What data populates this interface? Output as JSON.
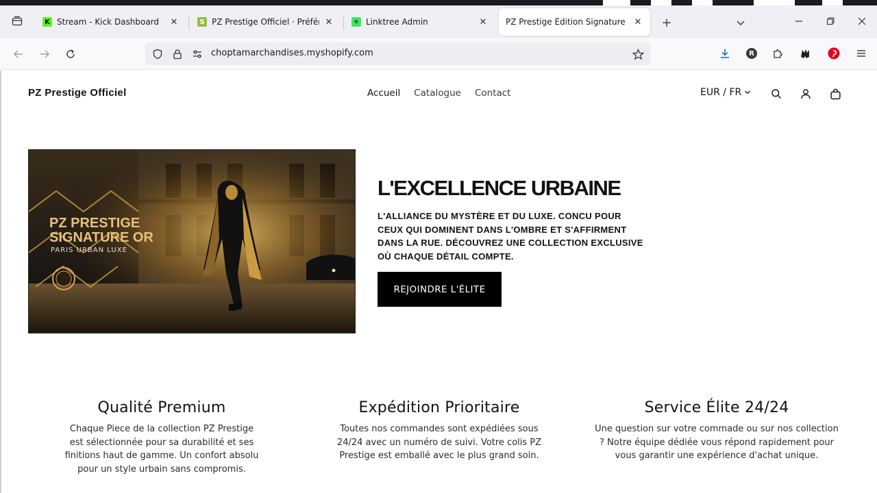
{
  "browser": {
    "tabs": [
      {
        "title": "Stream - Kick Dashboard",
        "favicon": "kick-icon",
        "color": "#53fc18"
      },
      {
        "title": "PZ Prestige Officiel · Préférences",
        "favicon": "shopify-icon",
        "color": "#95bf47"
      },
      {
        "title": "Linktree Admin",
        "favicon": "linktree-icon",
        "color": "#43e660"
      },
      {
        "title": "PZ Prestige Édition Signature Or - C",
        "favicon": "",
        "color": "#ffffff"
      }
    ],
    "url": "choptamarchandises.myshopify.com",
    "extension_badge": "R"
  },
  "store": {
    "name": "PZ Prestige Officiel",
    "nav": [
      "Accueil",
      "Catalogue",
      "Contact"
    ],
    "locale": "EUR / FR"
  },
  "hero": {
    "image_text": {
      "line1": "PZ PRESTIGE",
      "line2": "SIGNATURE OR",
      "line3": "PARIS URBAN LUXE"
    },
    "title": "L'EXCELLENCE URBAINE",
    "text": "L'ALLIANCE DU MYSTÈRE ET DU LUXE. CONCU POUR CEUX QUI DOMINENT DANS L'OMBRE ET S'AFFIRMENT DANS LA RUE. DÉCOUVREZ UNE COLLECTION EXCLUSIVE OÙ CHAQUE DÉTAIL COMPTE.",
    "button": "REJOINDRE L'ÉLITE"
  },
  "features": [
    {
      "title": "Qualité Premium",
      "lines": [
        "Chaque Piece de la collection PZ Prestige",
        "est sélectionnée pour sa durabilité et ses",
        "finitions haut de gamme. Un confort absolu",
        "pour un style urbain sans compromis."
      ]
    },
    {
      "title": "Expédition Prioritaire",
      "lines": [
        "Toutes nos commandes sont expédiées sous",
        "24/24 avec un numéro de suivi. Votre colis PZ",
        "Prestige est emballé avec le plus grand soin."
      ]
    },
    {
      "title": "Service Élite 24/24",
      "lines": [
        "Une question sur votre commade ou sur nos collection",
        "? Notre équipe dédiée vous répond rapidement pour",
        "vous garantir une expérience d'achat unique."
      ]
    }
  ]
}
